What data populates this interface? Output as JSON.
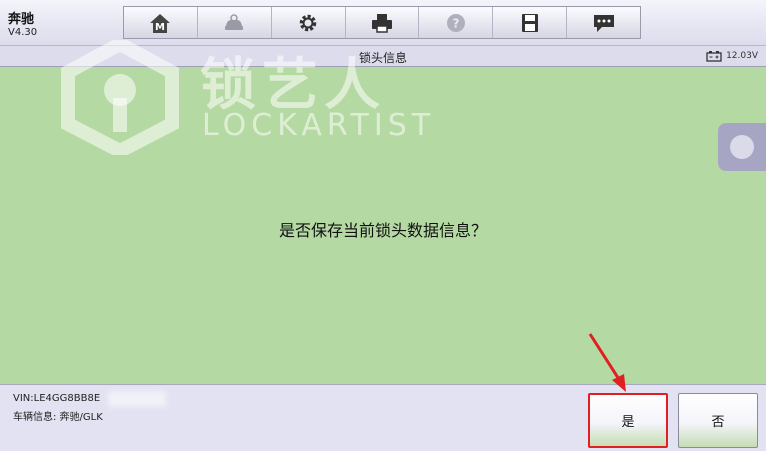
{
  "header": {
    "app_title": "奔驰",
    "version": "V4.30",
    "toolbar": [
      {
        "icon": "home-m-icon"
      },
      {
        "icon": "car-diagnosis-icon"
      },
      {
        "icon": "gear-icon"
      },
      {
        "icon": "printer-icon"
      },
      {
        "icon": "help-icon"
      },
      {
        "icon": "save-icon"
      },
      {
        "icon": "chat-icon"
      }
    ]
  },
  "title_bar": {
    "title": "锁头信息",
    "voltage": "12.03V"
  },
  "main": {
    "prompt": "是否保存当前锁头数据信息？"
  },
  "watermark": {
    "cn": "锁艺人",
    "en": "LOCKARTIST"
  },
  "footer": {
    "vin": "VIN:LE4GG8BB8E",
    "vehicle_info": "车辆信息: 奔驰/GLK",
    "yes_label": "是",
    "no_label": "否"
  },
  "colors": {
    "main_bg": "#b5d9a3",
    "highlight": "#e02020"
  }
}
